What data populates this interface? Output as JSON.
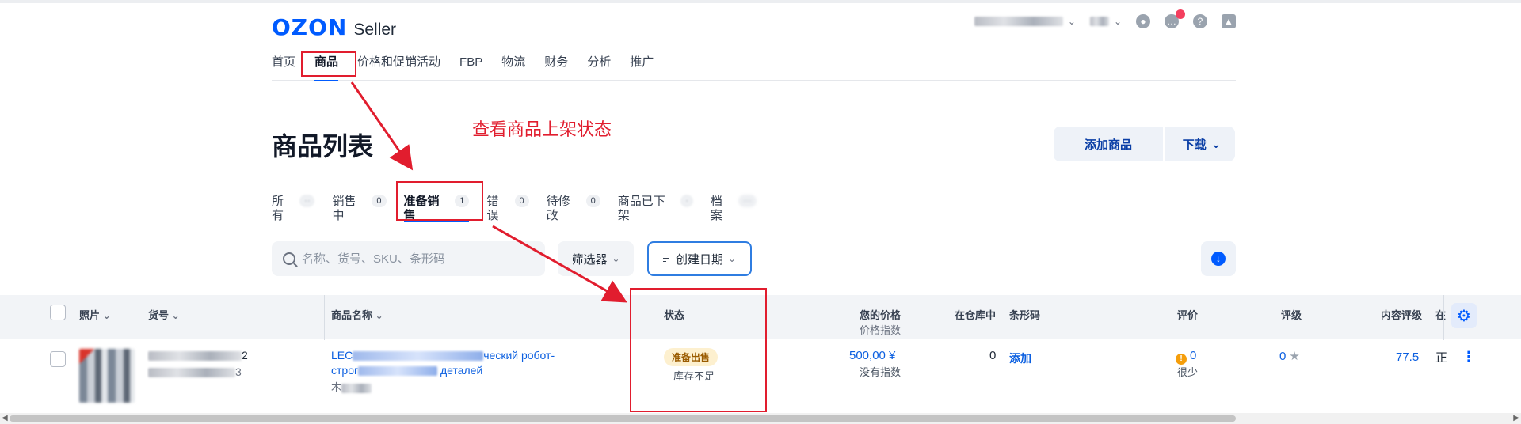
{
  "header": {
    "logo_brand": "OZON",
    "logo_product": "Seller",
    "nav": [
      "首页",
      "商品",
      "价格和促销活动",
      "FBP",
      "物流",
      "财务",
      "分析",
      "推广"
    ]
  },
  "page": {
    "title": "商品列表",
    "annotation": "查看商品上架状态",
    "add_button": "添加商品",
    "download_button": "下载"
  },
  "tabs": [
    {
      "label": "所有",
      "count": ""
    },
    {
      "label": "销售中",
      "count": "0"
    },
    {
      "label": "准备销售",
      "count": "1"
    },
    {
      "label": "错误",
      "count": "0"
    },
    {
      "label": "待修改",
      "count": "0"
    },
    {
      "label": "商品已下架",
      "count": ""
    },
    {
      "label": "档案",
      "count": ""
    }
  ],
  "filters": {
    "search_placeholder": "名称、货号、SKU、条形码",
    "filter_label": "筛选器",
    "sort_label": "创建日期"
  },
  "table": {
    "headers": {
      "photo": "照片",
      "sku": "货号",
      "name": "商品名称",
      "status": "状态",
      "price": "您的价格",
      "price_sub": "价格指数",
      "stock": "在仓库中",
      "barcode": "条形码",
      "reviews": "评价",
      "rating": "评级",
      "content_rating": "内容评级",
      "extra": "在"
    },
    "row": {
      "sku_suffix": "2",
      "sku_second_suffix": "3",
      "name_line1_a": "LEC",
      "name_line1_b": "ческий робот-",
      "name_line2_a": "строг",
      "name_line2_b": "деталей",
      "name_line3": "木",
      "status_badge": "准备出售",
      "status_text": "库存不足",
      "price": "500,00 ¥",
      "price_index": "没有指数",
      "stock": "0",
      "barcode_action": "添加",
      "reviews_count": "0",
      "reviews_label": "很少",
      "rating": "0",
      "content_rating": "77.5",
      "extra": "正"
    }
  }
}
